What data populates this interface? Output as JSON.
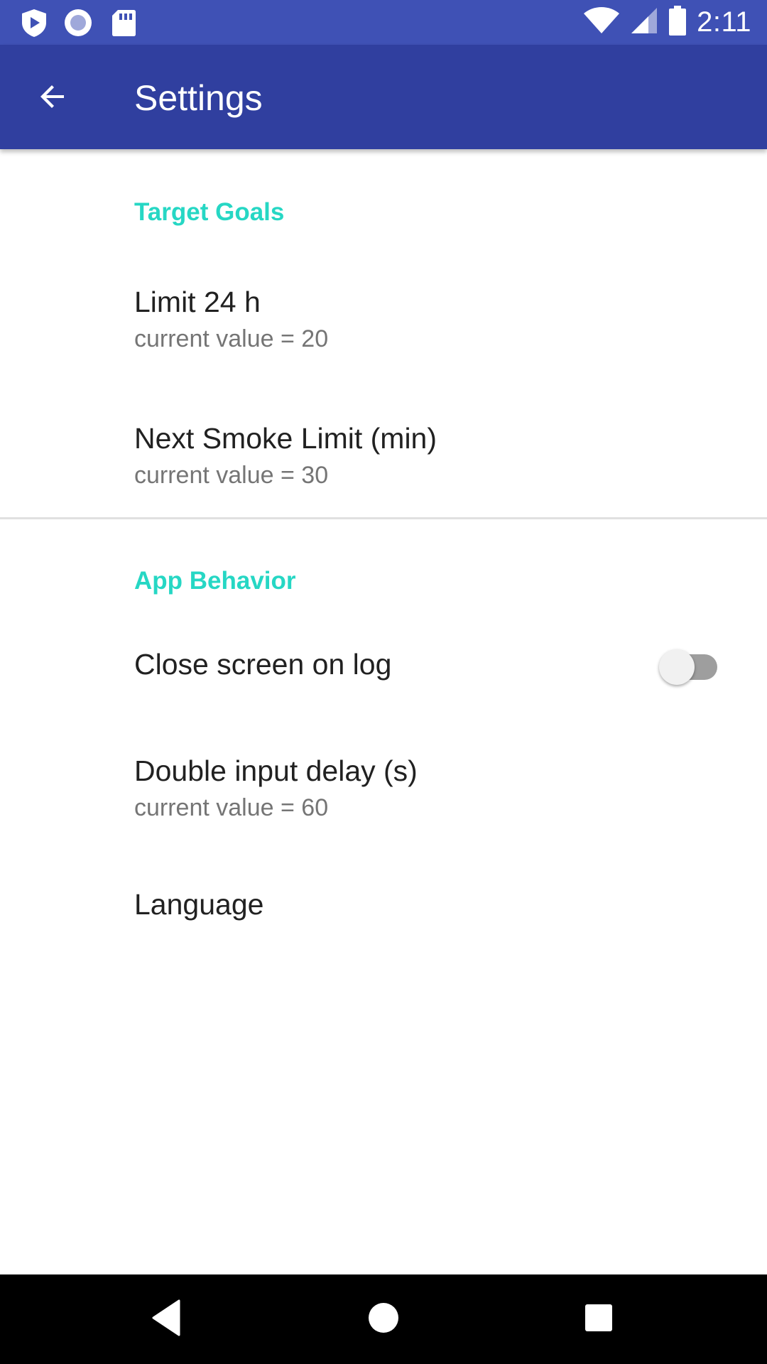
{
  "status_bar": {
    "time": "2:11",
    "left_icons": [
      "play-shield-icon",
      "record-icon",
      "sd-card-icon"
    ],
    "right_icons": [
      "wifi-icon",
      "cell-signal-icon",
      "battery-icon"
    ],
    "color": "#3f51b5"
  },
  "app_bar": {
    "title": "Settings",
    "back_icon": "arrow-back-icon",
    "color": "#303f9f"
  },
  "sections": [
    {
      "header": "Target Goals",
      "items": [
        {
          "title": "Limit 24 h",
          "summary": "current value = 20"
        },
        {
          "title": "Next Smoke Limit (min)",
          "summary": "current value = 30"
        }
      ]
    },
    {
      "header": "App Behavior",
      "items": [
        {
          "title": "Close screen on log",
          "switch_on": false
        },
        {
          "title": "Double input delay (s)",
          "summary": "current value = 60"
        },
        {
          "title": "Language"
        }
      ]
    }
  ],
  "nav_bar": {
    "buttons": [
      "back-triangle-icon",
      "home-circle-icon",
      "recents-square-icon"
    ]
  },
  "colors": {
    "category_accent": "#26d7c4",
    "primary": "#3f51b5",
    "primary_dark": "#303f9f"
  }
}
